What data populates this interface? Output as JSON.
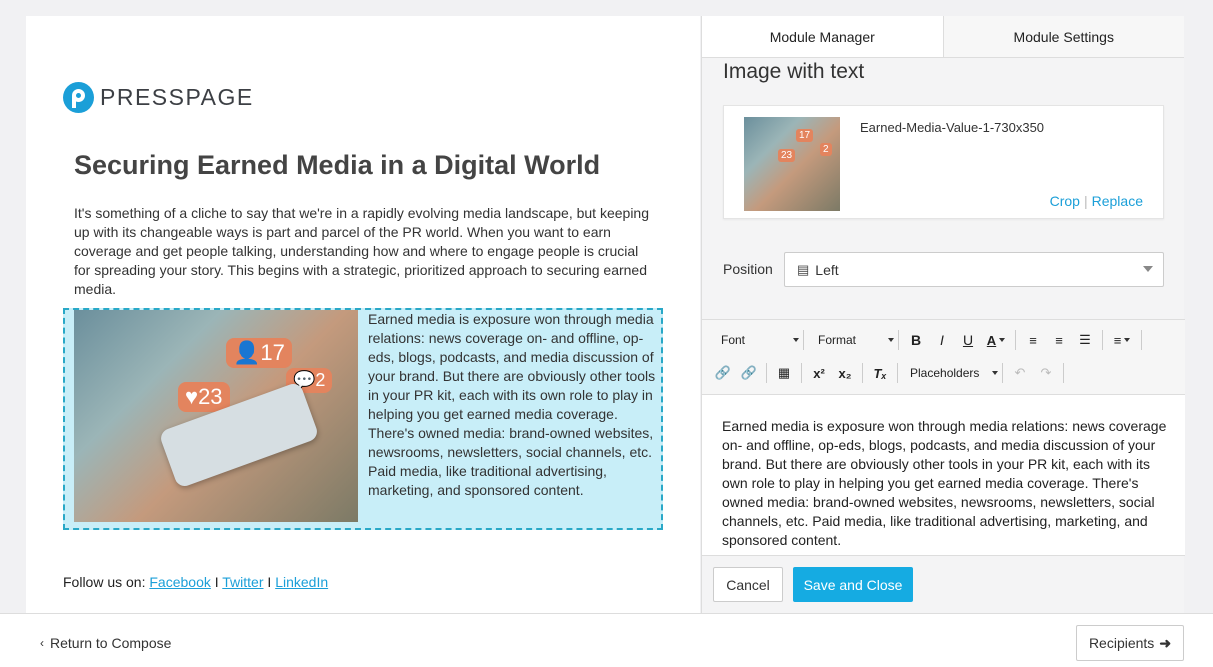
{
  "preview": {
    "logo_text": "PRESSPAGE",
    "headline": "Securing Earned Media in a Digital World",
    "intro": "It's something of a cliche to say that we're in a rapidly evolving media landscape, but keeping up with its changeable ways is part and parcel of the PR world. When you want to earn coverage and get people talking, understanding how and where to engage people is crucial for spreading your story. This begins with a strategic, prioritized approach to securing earned media.",
    "module_text": "Earned media is exposure won through media relations: news coverage on- and offline, op-eds, blogs, podcasts, and media discussion of your brand. But there are obviously other tools in your PR kit, each with its own role to play in helping you get earned media coverage. There's owned media: brand-owned websites, newsrooms, newsletters, social channels, etc. Paid media, like traditional advertising, marketing, and sponsored content.",
    "image_badges": [
      "17",
      "23",
      "2"
    ],
    "follow_prefix": "Follow us on: ",
    "links": [
      "Facebook",
      "Twitter",
      "LinkedIn"
    ],
    "link_sep": " I "
  },
  "panel": {
    "tabs": [
      "Module Manager",
      "Module Settings"
    ],
    "title": "Image with text",
    "image_name": "Earned-Media-Value-1-730x350",
    "crop_label": "Crop",
    "replace_label": "Replace",
    "position_label": "Position",
    "position_value": "Left",
    "toolbar": {
      "font_label": "Font",
      "format_label": "Format",
      "placeholders_label": "Placeholders"
    },
    "editor_text": "Earned media is exposure won through media relations: news coverage on- and offline, op-eds, blogs, podcasts, and media discussion of your brand. But there are obviously other tools in your PR kit, each with its own role to play in helping you get earned media coverage. There's owned media: brand-owned websites, newsrooms, newsletters, social channels, etc. Paid media, like traditional advertising, marketing, and sponsored content.",
    "cancel_label": "Cancel",
    "save_label": "Save and Close"
  },
  "footer": {
    "return_label": "Return to Compose",
    "recipients_label": "Recipients"
  },
  "colors": {
    "accent": "#15abe2",
    "module_bg": "#c8eef8",
    "module_border": "#29a8c7"
  }
}
